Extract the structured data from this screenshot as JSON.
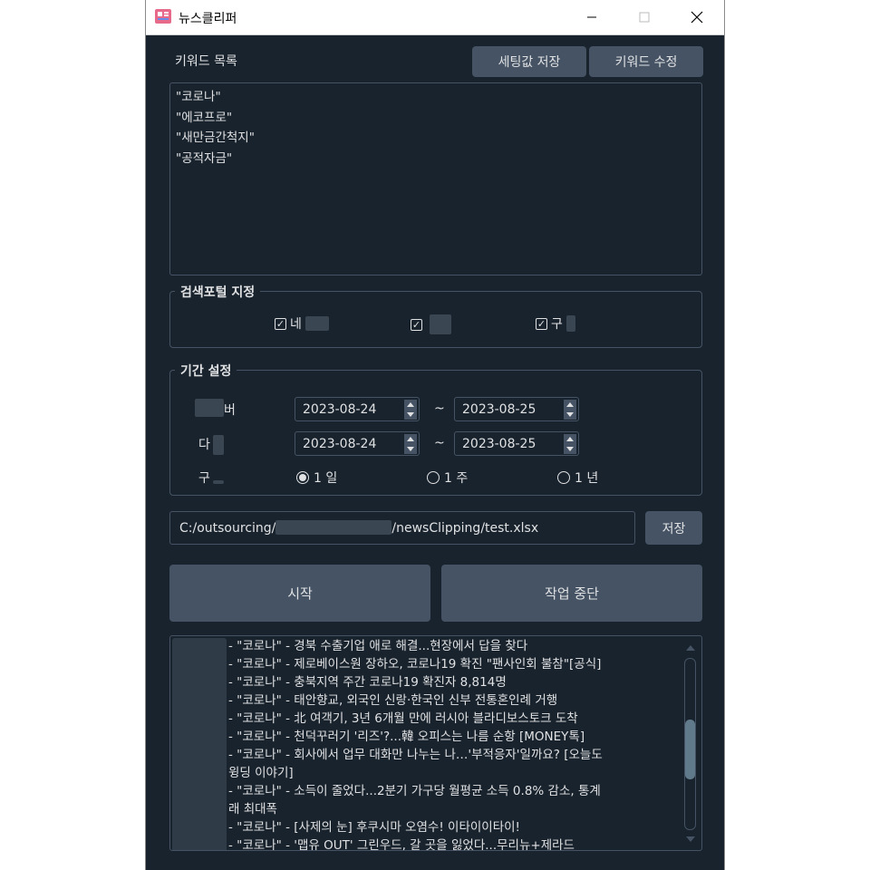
{
  "window": {
    "title": "뉴스클리퍼"
  },
  "keywords": {
    "label": "키워드 목록",
    "save_settings_label": "세팅값 저장",
    "edit_keywords_label": "키워드 수정",
    "items": [
      "\"코로나\"",
      "\"에코프로\"",
      "\"새만금간척지\"",
      "\"공적자금\""
    ]
  },
  "portal": {
    "title": "검색포털 지정",
    "options": [
      {
        "label": "네",
        "checked": true
      },
      {
        "label": "",
        "checked": true
      },
      {
        "label": "구",
        "checked": true
      }
    ]
  },
  "period": {
    "title": "기간 설정",
    "rows": [
      {
        "label": "버",
        "from": "2023-08-24",
        "to": "2023-08-25"
      },
      {
        "label": "다",
        "from": "2023-08-24",
        "to": "2023-08-25"
      }
    ],
    "separator": "~",
    "unit_label": "구",
    "units": [
      {
        "label": "1 일",
        "selected": true
      },
      {
        "label": "1 주",
        "selected": false
      },
      {
        "label": "1 년",
        "selected": false
      }
    ]
  },
  "output": {
    "path_prefix": "C:/outsourcing/",
    "path_suffix": "/newsClipping/test.xlsx",
    "save_label": "저장"
  },
  "actions": {
    "start_label": "시작",
    "stop_label": "작업 중단"
  },
  "log": {
    "lines": [
      "- \"코로나\" - 경북 수출기업 애로 해결...현장에서 답을 찾다",
      "- \"코로나\" - 제로베이스원 장하오, 코로나19 확진 \"팬사인회 불참\"[공식]",
      "- \"코로나\" - 충북지역 주간 코로나19 확진자 8,814명",
      "- \"코로나\" - 태안향교, 외국인 신랑·한국인 신부 전통혼인례 거행",
      "- \"코로나\" - 北 여객기, 3년 6개월 만에 러시아 블라디보스토크 도착",
      "- \"코로나\" - 천덕꾸러기 '리즈'?...韓 오피스는 나름 순항 [MONEY톡]",
      "- \"코로나\" - 회사에서 업무 대화만 나누는 나…'부적응자'일까요? [오늘도",
      "  윙딩 이야기]",
      "- \"코로나\" - 소득이 줄었다...2분기 가구당 월평균 소득 0.8% 감소, 통계",
      "  래 최대폭",
      "- \"코로나\" - [사제의 눈] 후쿠시마 오염수! 이타이이타이!",
      "- \"코로나\" - '맵유 OUT' 그린우드, 갈 곳을 잃었다...무리뉴+제라드"
    ]
  }
}
